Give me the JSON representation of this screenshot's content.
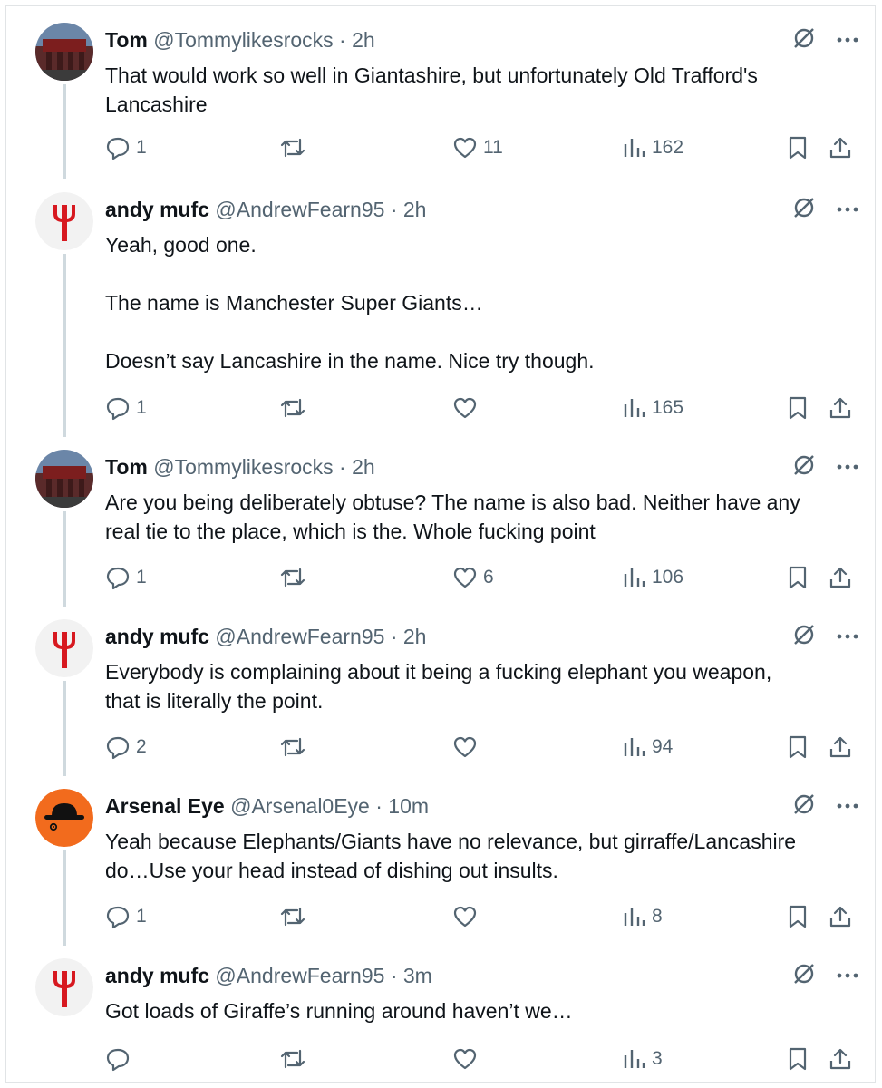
{
  "tweets": [
    {
      "avatar": "stadium-avatar",
      "name": "Tom",
      "handle": "@Tommylikesrocks",
      "time": "· 2h",
      "text": "That would work so well in Giantashire, but unfortunately Old Trafford's\nLancashire",
      "replies": "1",
      "retweets": "",
      "likes": "11",
      "views": "162"
    },
    {
      "avatar": "trident-avatar",
      "name": "andy mufc",
      "handle": "@AndrewFearn95",
      "time": "· 2h",
      "text": "Yeah, good one.\n\nThe name is Manchester Super Giants…\n\nDoesn’t say Lancashire in the name. Nice try though.",
      "replies": "1",
      "retweets": "",
      "likes": "",
      "views": "165"
    },
    {
      "avatar": "stadium-avatar",
      "name": "Tom",
      "handle": "@Tommylikesrocks",
      "time": "· 2h",
      "text": "Are you being deliberately obtuse? The name is also bad. Neither have any\nreal tie to the place, which is the. Whole fucking point",
      "replies": "1",
      "retweets": "",
      "likes": "6",
      "views": "106"
    },
    {
      "avatar": "trident-avatar",
      "name": "andy mufc",
      "handle": "@AndrewFearn95",
      "time": "· 2h",
      "text": "Everybody is complaining about it being a fucking elephant you weapon,\nthat is literally the point.",
      "replies": "2",
      "retweets": "",
      "likes": "",
      "views": "94"
    },
    {
      "avatar": "bowler-hat-avatar",
      "name": "Arsenal Eye",
      "handle": "@Arsenal0Eye",
      "time": "· 10m",
      "text": "Yeah because Elephants/Giants have no relevance, but girraffe/Lancashire\ndo…Use your head instead of dishing out insults.",
      "replies": "1",
      "retweets": "",
      "likes": "",
      "views": "8"
    },
    {
      "avatar": "trident-avatar",
      "name": "andy mufc",
      "handle": "@AndrewFearn95",
      "time": "· 3m",
      "text": "Got loads of Giraffe’s running around haven’t we…",
      "replies": "",
      "retweets": "",
      "likes": "",
      "views": "3"
    }
  ],
  "colors": {
    "text": "#0f1419",
    "muted": "#536471",
    "thread_line": "#cfd9de",
    "trident_red": "#d71920",
    "arsenal_orange": "#f26b1d"
  }
}
